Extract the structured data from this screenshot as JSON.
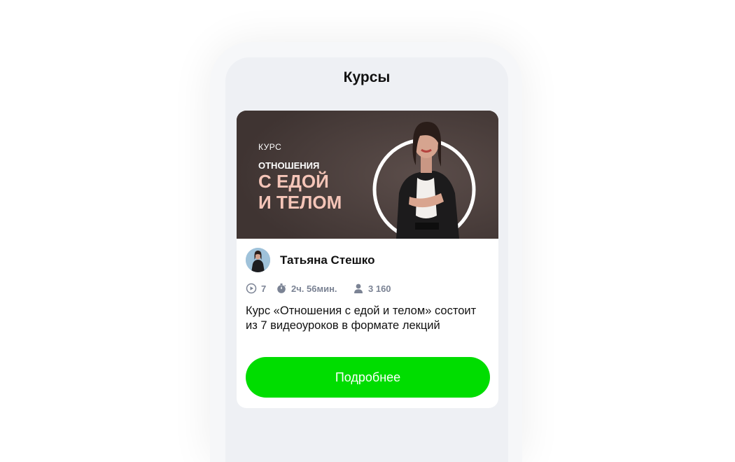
{
  "header": {
    "title": "Курсы"
  },
  "course": {
    "banner": {
      "kicker": "КУРС",
      "line1": "ОТНОШЕНИЯ",
      "line2": "С ЕДОЙ",
      "line3": "И ТЕЛОМ"
    },
    "author": {
      "name": "Татьяна Стешко"
    },
    "stats": {
      "lessons": "7",
      "duration": "2ч. 56мин.",
      "students": "3 160"
    },
    "description": "Курс «Отношения с едой и телом» состоит из 7 видеоуроков в формате лекций",
    "more_button": "Подробнее"
  },
  "colors": {
    "accent": "#00dd00",
    "banner_bg": "#4a3d3b",
    "banner_title": "#f5c5b8",
    "stats": "#7b8394"
  },
  "icons": {
    "lessons": "play-circle-icon",
    "duration": "stopwatch-icon",
    "students": "person-icon"
  }
}
